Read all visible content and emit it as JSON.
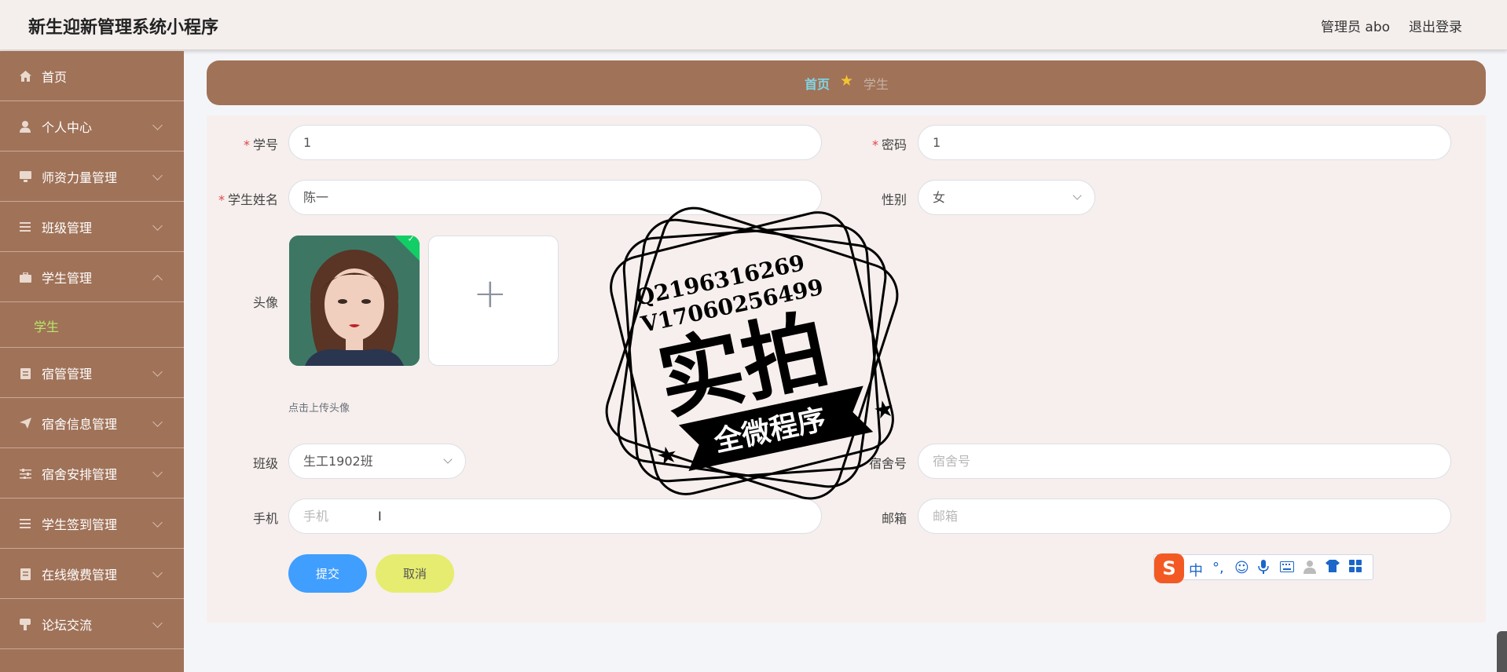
{
  "header": {
    "app_title": "新生迎新管理系统小程序",
    "admin_label": "管理员 abo",
    "logout_label": "退出登录"
  },
  "sidebar": {
    "items": [
      {
        "label": "首页",
        "icon": "home-icon",
        "expandable": false
      },
      {
        "label": "个人中心",
        "icon": "user-icon",
        "expandable": true
      },
      {
        "label": "师资力量管理",
        "icon": "monitor-icon",
        "expandable": true
      },
      {
        "label": "班级管理",
        "icon": "list-icon",
        "expandable": true
      },
      {
        "label": "学生管理",
        "icon": "briefcase-icon",
        "expandable": true,
        "expanded": true,
        "children": [
          "学生"
        ]
      },
      {
        "label": "宿管管理",
        "icon": "clipboard-icon",
        "expandable": true
      },
      {
        "label": "宿舍信息管理",
        "icon": "send-icon",
        "expandable": true
      },
      {
        "label": "宿舍安排管理",
        "icon": "sliders-icon",
        "expandable": true
      },
      {
        "label": "学生签到管理",
        "icon": "list-icon",
        "expandable": true
      },
      {
        "label": "在线缴费管理",
        "icon": "receipt-icon",
        "expandable": true
      },
      {
        "label": "论坛交流",
        "icon": "chat-icon",
        "expandable": true
      }
    ],
    "active_child": "学生"
  },
  "breadcrumb": {
    "home": "首页",
    "current": "学生"
  },
  "form": {
    "student_no": {
      "label": "学号",
      "value": "1",
      "required": true
    },
    "password": {
      "label": "密码",
      "value": "1",
      "required": true
    },
    "student_name": {
      "label": "学生姓名",
      "value": "陈一",
      "required": true
    },
    "gender": {
      "label": "性别",
      "value": "女"
    },
    "avatar": {
      "label": "头像",
      "hint": "点击上传头像",
      "plus": "+"
    },
    "class": {
      "label": "班级",
      "value": "生工1902班"
    },
    "dorm_no": {
      "label": "宿舍号",
      "placeholder": "宿舍号"
    },
    "phone": {
      "label": "手机",
      "placeholder": "手机"
    },
    "email": {
      "label": "邮箱",
      "placeholder": "邮箱"
    },
    "submit_label": "提交",
    "cancel_label": "取消"
  },
  "watermark": {
    "line1": "Q2196316269",
    "line2": "V17060256499",
    "big": "实拍",
    "banner": "全微程序"
  },
  "ime_toolbar": {
    "logo": "S",
    "lang": "中",
    "punct": "°,"
  },
  "colors": {
    "sidebar_bg": "#a07258",
    "active_sub": "#b8e86a",
    "breadcrumb_home": "#7fd6e6",
    "submit": "#409eff",
    "cancel": "#e6ec6f",
    "required": "#e0454a"
  }
}
